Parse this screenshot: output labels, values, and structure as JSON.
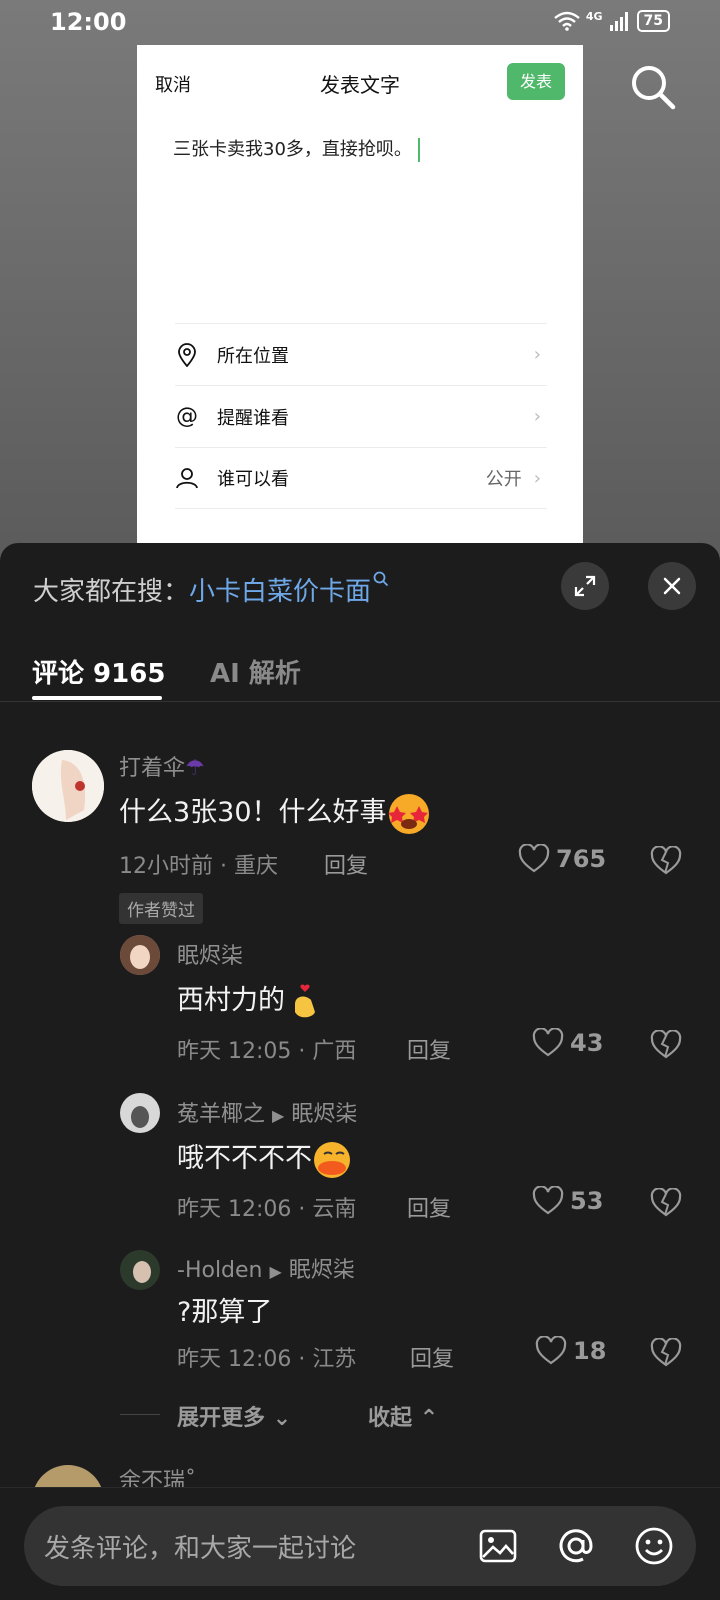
{
  "status_bar": {
    "time": "12:00",
    "network": "4G",
    "battery": "75"
  },
  "post_card": {
    "cancel": "取消",
    "title": "发表文字",
    "publish": "发表",
    "content": "三张卡卖我30多，直接抢呗。",
    "rows": [
      {
        "label": "所在位置",
        "value": "",
        "icon": "location-pin-icon"
      },
      {
        "label": "提醒谁看",
        "value": "",
        "icon": "at-icon"
      },
      {
        "label": "谁可以看",
        "value": "公开",
        "icon": "person-icon"
      }
    ]
  },
  "sheet": {
    "hot_search_prefix": "大家都在搜：",
    "hot_search_keyword": "小卡白菜价卡面",
    "tabs": {
      "comments": "评论 9165",
      "ai": "AI 解析"
    }
  },
  "comments": [
    {
      "user": "打着伞",
      "text": "什么3张30！什么好事",
      "meta": "12小时前 · 重庆",
      "reply": "回复",
      "likes": "765",
      "badge": "作者赞过"
    }
  ],
  "replies": [
    {
      "user": "眠烬柒",
      "to": "",
      "text": "西村力的",
      "meta": "昨天 12:05 · 广西",
      "reply": "回复",
      "likes": "43"
    },
    {
      "user": "菟羊椰之",
      "to": "眠烬柒",
      "text": "哦不不不不",
      "meta": "昨天 12:06 · 云南",
      "reply": "回复",
      "likes": "53"
    },
    {
      "user": "-Holden",
      "to": "眠烬柒",
      "text": "?那算了",
      "meta": "昨天 12:06 · 江苏",
      "reply": "回复",
      "likes": "18"
    }
  ],
  "expand": {
    "more": "展开更多",
    "collapse": "收起"
  },
  "next_user": "余不瑞˚",
  "input": {
    "placeholder": "发条评论，和大家一起讨论"
  },
  "colors": {
    "publish": "#4fb86a",
    "keyword": "#6fa8e8",
    "sheet_bg": "#1c1c1c"
  }
}
